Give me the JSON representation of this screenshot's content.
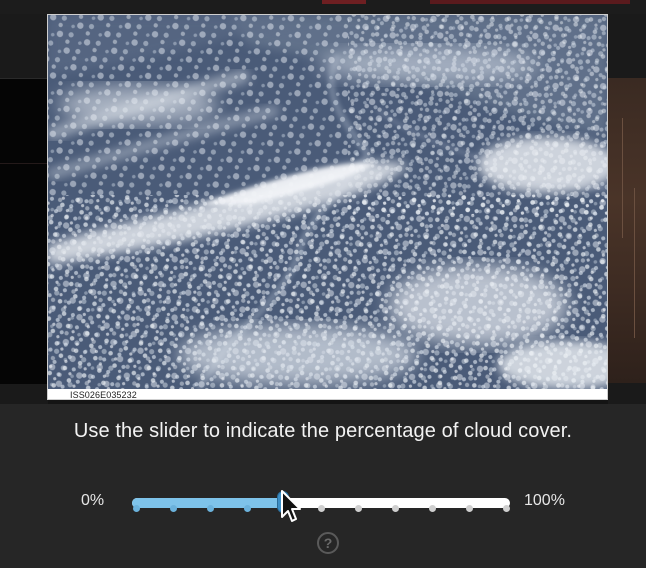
{
  "photo": {
    "caption": "ISS026E035232",
    "subject": "astronaut photo of cloud-covered landscape with river"
  },
  "panel": {
    "instruction": "Use the slider to indicate the percentage of cloud cover.",
    "min_label": "0%",
    "max_label": "100%",
    "help_label": "?"
  },
  "slider": {
    "value_fraction": 0.4,
    "tick_count": 11,
    "fill_color": "#7ec3ea",
    "thumb_color": "#3d8fc6",
    "track_color": "#ffffff"
  },
  "icons": {
    "help": "question-mark-circle-icon",
    "cursor": "mouse-pointer-icon"
  }
}
